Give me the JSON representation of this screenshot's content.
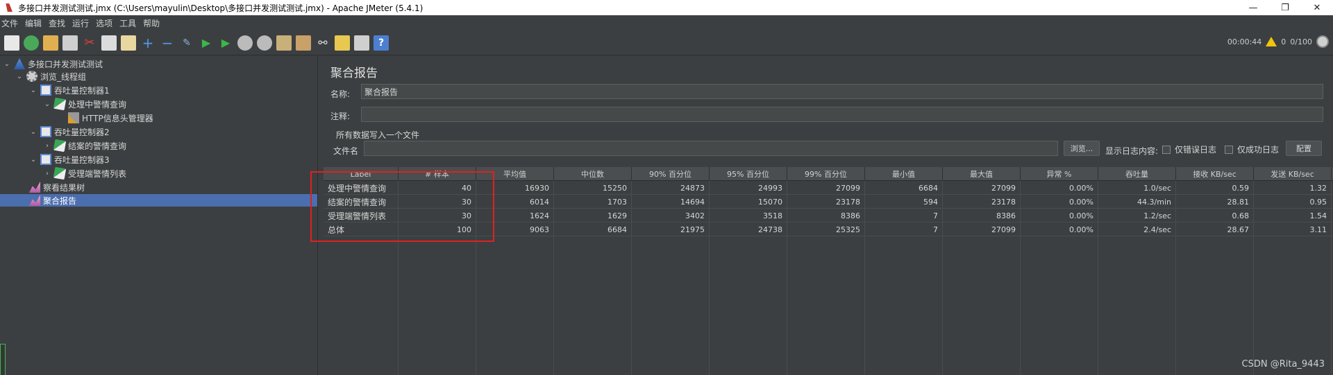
{
  "window": {
    "title": "多接口并发测试测试.jmx (C:\\Users\\mayulin\\Desktop\\多接口并发测试测试.jmx) - Apache JMeter (5.4.1)",
    "minimize": "—",
    "maximize": "❐",
    "close": "✕"
  },
  "menu": [
    "文件",
    "编辑",
    "查找",
    "运行",
    "选项",
    "工具",
    "帮助"
  ],
  "toolbar": {
    "elapsed": "00:00:44",
    "warnings": "0",
    "threads": "0/100"
  },
  "tree": [
    {
      "label": "多接口并发测试测试",
      "icon": "test-plan-icon"
    },
    {
      "label": "浏览_线程组",
      "icon": "thread-group-icon"
    },
    {
      "label": "吞吐量控制器1",
      "icon": "controller-icon"
    },
    {
      "label": "处理中警情查询",
      "icon": "sampler-icon"
    },
    {
      "label": "HTTP信息头管理器",
      "icon": "config-tool-icon"
    },
    {
      "label": "吞吐量控制器2",
      "icon": "controller-icon"
    },
    {
      "label": "结案的警情查询",
      "icon": "sampler-icon"
    },
    {
      "label": "吞吐量控制器3",
      "icon": "controller-icon"
    },
    {
      "label": "受理端警情列表",
      "icon": "sampler-icon"
    },
    {
      "label": "察看结果树",
      "icon": "listener-icon"
    },
    {
      "label": "聚合报告",
      "icon": "listener-icon"
    }
  ],
  "panel": {
    "title": "聚合报告",
    "name_label": "名称:",
    "name_value": "聚合报告",
    "comment_label": "注释:",
    "comment_value": "",
    "group_title": "所有数据写入一个文件",
    "file_label": "文件名",
    "file_value": "",
    "browse_button": "浏览...",
    "log_label": "显示日志内容:",
    "errors_only": "仅错误日志",
    "success_only": "仅成功日志",
    "config_button": "配置"
  },
  "table": {
    "headers": [
      "Label",
      "# 样本",
      "平均值",
      "中位数",
      "90% 百分位",
      "95% 百分位",
      "99% 百分位",
      "最小值",
      "最大值",
      "异常 %",
      "吞吐量",
      "接收 KB/sec",
      "发送 KB/sec"
    ],
    "rows": [
      [
        "处理中警情查询",
        "40",
        "16930",
        "15250",
        "24873",
        "24993",
        "27099",
        "6684",
        "27099",
        "0.00%",
        "1.0/sec",
        "0.59",
        "1.32"
      ],
      [
        "结案的警情查询",
        "30",
        "6014",
        "1703",
        "14694",
        "15070",
        "23178",
        "594",
        "23178",
        "0.00%",
        "44.3/min",
        "28.81",
        "0.95"
      ],
      [
        "受理端警情列表",
        "30",
        "1624",
        "1629",
        "3402",
        "3518",
        "8386",
        "7",
        "8386",
        "0.00%",
        "1.2/sec",
        "0.68",
        "1.54"
      ],
      [
        "总体",
        "100",
        "9063",
        "6684",
        "21975",
        "24738",
        "25325",
        "7",
        "27099",
        "0.00%",
        "2.4/sec",
        "28.67",
        "3.11"
      ]
    ]
  },
  "watermark": "CSDN @Rita_9443",
  "colors": {
    "background": "#3c3f41",
    "selection": "#4b6eaf",
    "highlight": "#e02020"
  }
}
